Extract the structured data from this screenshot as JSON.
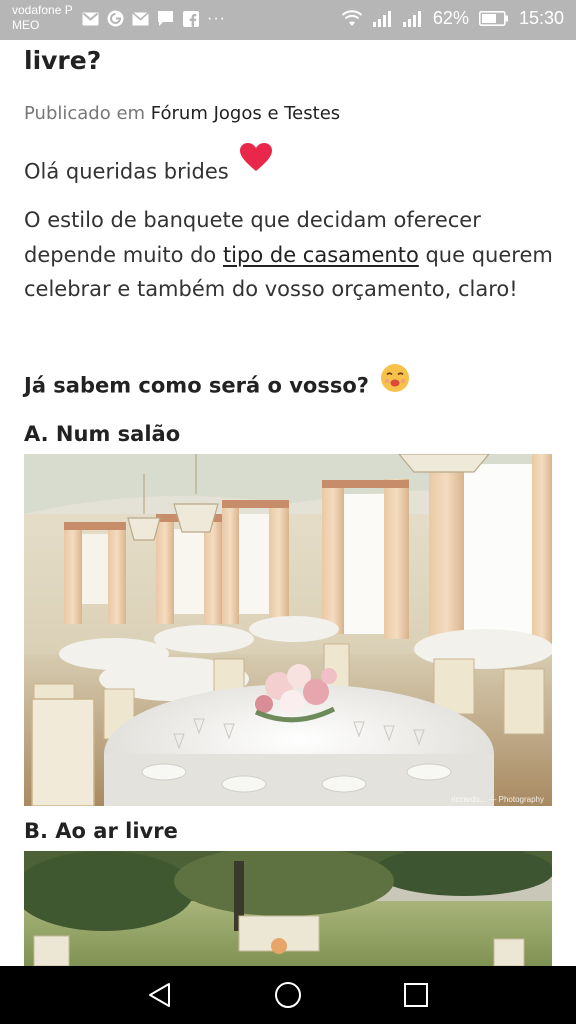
{
  "status_bar": {
    "carrier_line1": "vodafone P",
    "carrier_line2": "MEO",
    "notification_icons": [
      "gmail-icon",
      "app-icon",
      "email-icon",
      "chat-icon",
      "facebook-icon"
    ],
    "more": "···",
    "battery_percent": "62%",
    "time": "15:30"
  },
  "article": {
    "title_fragment": "livre?",
    "published_prefix": "Publicado em ",
    "forum_name": "Fórum Jogos e Testes",
    "greeting": "Olá queridas brides",
    "body_before_link": "O estilo de banquete que decidam oferecer depende muito do ",
    "body_link": "tipo de casamento",
    "body_after_link": " que querem celebrar e também do vosso orçamento, claro!",
    "question": "Já sabem como será o vosso?",
    "option_a": "A. Num salão",
    "option_b": "B. Ao ar livre",
    "photo_credit": "riccardo... — Photography"
  },
  "colors": {
    "status_bar_bg": "#b6b6b6",
    "nav_bar_bg": "#000000",
    "heart": "#e8274b",
    "text": "#222222",
    "muted": "#777777"
  }
}
